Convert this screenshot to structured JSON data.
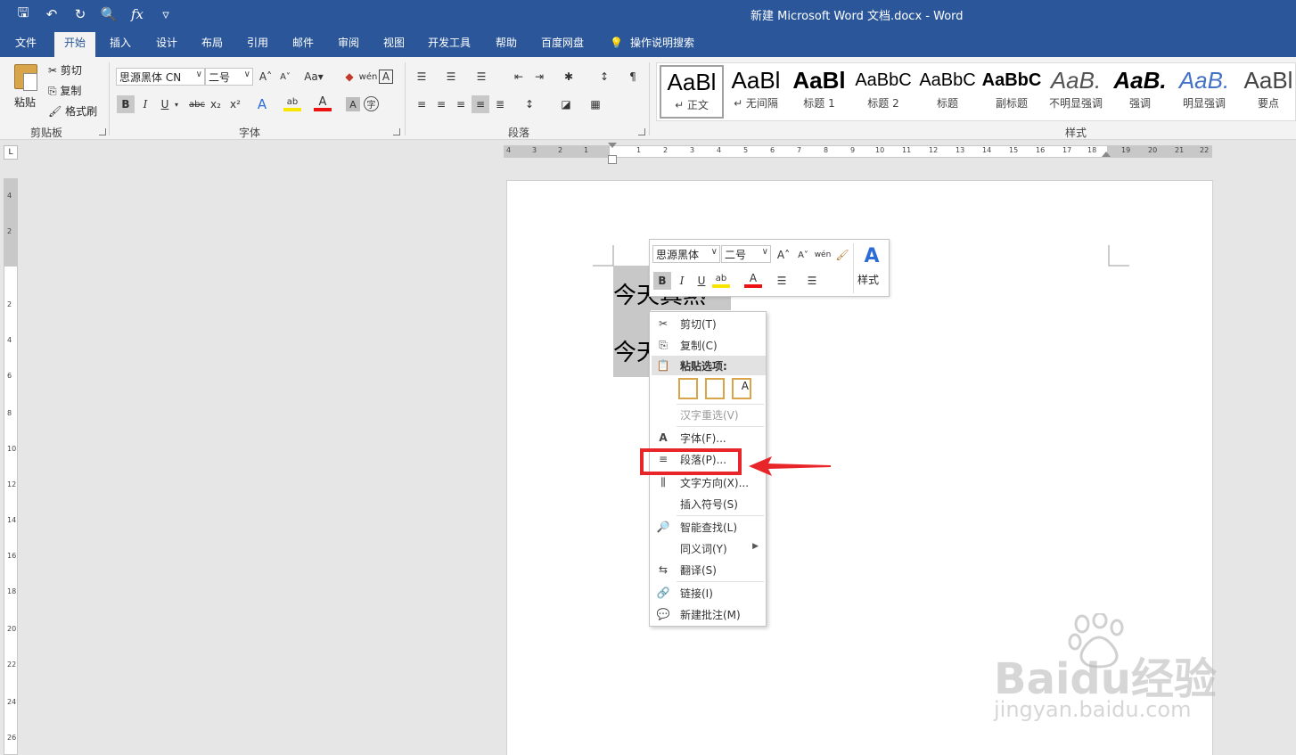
{
  "titlebar": {
    "title": "新建 Microsoft Word 文档.docx  -  Word",
    "qat": [
      {
        "name": "save-icon",
        "glyph": "🖫"
      },
      {
        "name": "undo-icon",
        "glyph": "↶"
      },
      {
        "name": "redo-icon",
        "glyph": "↻"
      },
      {
        "name": "print-preview-icon",
        "glyph": "🔍"
      },
      {
        "name": "formula-icon",
        "glyph": "fx"
      },
      {
        "name": "customize-qat-icon",
        "glyph": "▿"
      }
    ]
  },
  "tabs": [
    "文件",
    "开始",
    "插入",
    "设计",
    "布局",
    "引用",
    "邮件",
    "审阅",
    "视图",
    "开发工具",
    "帮助",
    "百度网盘"
  ],
  "active_tab": "开始",
  "tell_me": "操作说明搜索",
  "clipboard": {
    "paste": "粘贴",
    "cut": "剪切",
    "copy": "复制",
    "format_painter": "格式刷",
    "label": "剪贴板"
  },
  "font": {
    "name": "思源黑体 CN",
    "size": "二号",
    "label": "字体",
    "case": "Aa",
    "bold": "B",
    "italic": "I",
    "underline": "U",
    "strike": "abc",
    "sub": "x₂",
    "sup": "x²"
  },
  "paragraph": {
    "label": "段落"
  },
  "styles": {
    "label": "样式",
    "items": [
      {
        "sample": "AaBl",
        "name": "↵ 正文",
        "selected": true
      },
      {
        "sample": "AaBl",
        "name": "↵ 无间隔",
        "selected": false
      },
      {
        "sample": "AaBl",
        "name": "标题 1",
        "selected": false
      },
      {
        "sample": "AaBbC",
        "name": "标题 2",
        "selected": false
      },
      {
        "sample": "AaBbC",
        "name": "标题",
        "selected": false
      },
      {
        "sample": "AaBbC",
        "name": "副标题",
        "selected": false
      },
      {
        "sample": "AaB.",
        "name": "不明显强调",
        "selected": false
      },
      {
        "sample": "AaB.",
        "name": "强调",
        "selected": false
      },
      {
        "sample": "AaB.",
        "name": "明显强调",
        "selected": false
      },
      {
        "sample": "AaBl",
        "name": "要点",
        "selected": false
      }
    ]
  },
  "ruler": {
    "corner": "L",
    "h_ticks": [
      "4",
      "3",
      "2",
      "1",
      "1",
      "2",
      "3",
      "4",
      "5",
      "6",
      "7",
      "8",
      "9",
      "10",
      "11",
      "12",
      "13",
      "14",
      "15",
      "16",
      "17",
      "18",
      "19",
      "20",
      "21",
      "22"
    ],
    "v_ticks": [
      "4",
      "2",
      "2",
      "4",
      "6",
      "8",
      "10",
      "12",
      "14",
      "16",
      "18",
      "20",
      "22",
      "24",
      "26"
    ]
  },
  "document": {
    "line1": "今天真熱",
    "line2": "今天"
  },
  "mini_toolbar": {
    "font": "思源黑体",
    "size": "二号",
    "styles": "样式"
  },
  "context_menu": [
    {
      "name": "cut",
      "label": "剪切(T)",
      "icon": "scissors-icon",
      "glyph": "✂",
      "disabled": false
    },
    {
      "name": "copy",
      "label": "复制(C)",
      "icon": "copy-icon",
      "glyph": "⎘",
      "disabled": false
    },
    {
      "name": "paste-options",
      "label": "粘贴选项:",
      "icon": "paste-icon",
      "glyph": "📋",
      "disabled": false,
      "header": true
    },
    {
      "name": "reconvert",
      "label": "汉字重选(V)",
      "icon": "",
      "glyph": "",
      "disabled": true
    },
    {
      "name": "font",
      "label": "字体(F)...",
      "icon": "font-icon",
      "glyph": "A",
      "disabled": false
    },
    {
      "name": "paragraph",
      "label": "段落(P)...",
      "icon": "paragraph-icon",
      "glyph": "≡",
      "disabled": false
    },
    {
      "name": "text-direction",
      "label": "文字方向(X)...",
      "icon": "text-direction-icon",
      "glyph": "⫼",
      "disabled": false
    },
    {
      "name": "insert-symbol",
      "label": "插入符号(S)",
      "icon": "",
      "glyph": "",
      "disabled": false
    },
    {
      "name": "smart-lookup",
      "label": "智能查找(L)",
      "icon": "smart-lookup-icon",
      "glyph": "🔎",
      "disabled": false
    },
    {
      "name": "synonyms",
      "label": "同义词(Y)",
      "icon": "",
      "glyph": "",
      "disabled": false,
      "submenu": true
    },
    {
      "name": "translate",
      "label": "翻译(S)",
      "icon": "translate-icon",
      "glyph": "⇆",
      "disabled": false
    },
    {
      "name": "link",
      "label": "链接(I)",
      "icon": "link-icon",
      "glyph": "🔗",
      "disabled": false
    },
    {
      "name": "new-comment",
      "label": "新建批注(M)",
      "icon": "comment-icon",
      "glyph": "💬",
      "disabled": false
    }
  ],
  "watermark": {
    "brand": "Baidu经验",
    "url": "jingyan.baidu.com"
  },
  "colors": {
    "brand": "#2b579a",
    "highlight": "#e8262a",
    "selection": "#c8c8c8"
  }
}
